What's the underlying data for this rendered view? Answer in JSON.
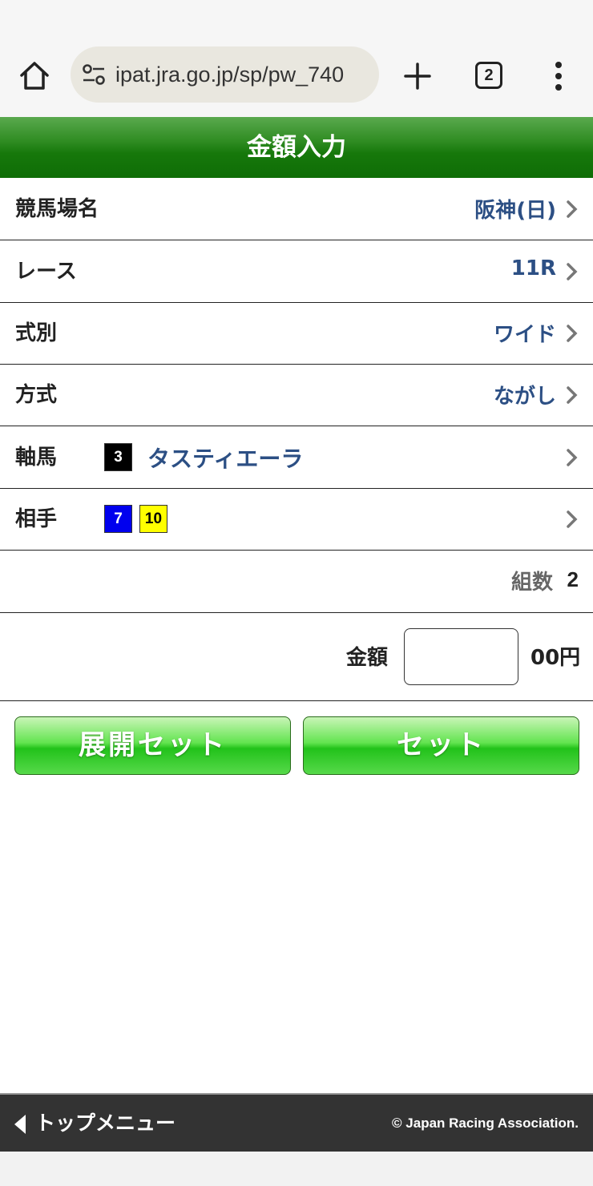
{
  "browser": {
    "url": "ipat.jra.go.jp/sp/pw_740",
    "tab_count": "2",
    "icons": {
      "home": "home-icon",
      "site_settings": "tune-icon",
      "new_tab": "plus-icon",
      "menu": "more-vert-icon"
    }
  },
  "header": {
    "title": "金額入力"
  },
  "rows": {
    "venue": {
      "label": "競馬場名",
      "value": "阪神(日)"
    },
    "race": {
      "label": "レース",
      "value": "11R"
    },
    "bet_type": {
      "label": "式別",
      "value": "ワイド"
    },
    "method": {
      "label": "方式",
      "value": "ながし"
    },
    "axis": {
      "label": "軸馬",
      "number": "3",
      "number_color": "#000000",
      "name": "タスティエーラ"
    },
    "partners": {
      "label": "相手",
      "horses": [
        {
          "number": "7",
          "color": "#0000ee"
        },
        {
          "number": "10",
          "color": "#ffff00"
        }
      ]
    },
    "combos": {
      "label": "組数",
      "value": "2"
    }
  },
  "amount": {
    "label": "金額",
    "value": "",
    "unit": "00円"
  },
  "buttons": {
    "expand_set": "展開セット",
    "set": "セット"
  },
  "footer": {
    "menu": "トップメニュー",
    "copyright": "© Japan Racing Association."
  },
  "colors": {
    "header_green": "#16780b",
    "value_blue": "#2c4f84",
    "button_green": "#22c21a"
  }
}
